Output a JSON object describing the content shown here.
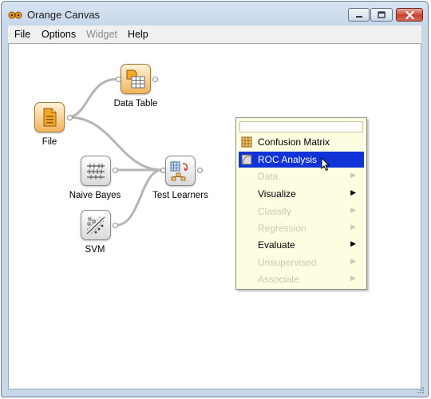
{
  "window": {
    "title": "Orange Canvas",
    "app_icon": "orange-app-icon",
    "controls": [
      "minimize-icon",
      "maximize-icon",
      "close-icon"
    ]
  },
  "menubar": {
    "items": [
      {
        "label": "File",
        "enabled": true
      },
      {
        "label": "Options",
        "enabled": true
      },
      {
        "label": "Widget",
        "enabled": false
      },
      {
        "label": "Help",
        "enabled": true
      }
    ]
  },
  "canvas": {
    "widgets": [
      {
        "id": "file",
        "label": "File",
        "icon": "file-widget-icon"
      },
      {
        "id": "data_table",
        "label": "Data Table",
        "icon": "data-table-icon"
      },
      {
        "id": "naive_bayes",
        "label": "Naive Bayes",
        "icon": "naive-bayes-icon"
      },
      {
        "id": "test_learners",
        "label": "Test Learners",
        "icon": "test-learners-icon"
      },
      {
        "id": "svm",
        "label": "SVM",
        "icon": "svm-icon"
      }
    ]
  },
  "popup": {
    "search_value": "",
    "items": [
      {
        "label": "Confusion Matrix",
        "icon": "confusion-matrix-icon",
        "enabled": true,
        "highlighted": false,
        "submenu": false
      },
      {
        "label": "ROC Analysis",
        "icon": "roc-analysis-icon",
        "enabled": true,
        "highlighted": true,
        "submenu": false
      },
      {
        "label": "Data",
        "enabled": false,
        "submenu": true
      },
      {
        "label": "Visualize",
        "enabled": true,
        "submenu": true
      },
      {
        "label": "Classify",
        "enabled": false,
        "submenu": true
      },
      {
        "label": "Regression",
        "enabled": false,
        "submenu": true
      },
      {
        "label": "Evaluate",
        "enabled": true,
        "submenu": true
      },
      {
        "label": "Unsupervised",
        "enabled": false,
        "submenu": true
      },
      {
        "label": "Associate",
        "enabled": false,
        "submenu": true
      }
    ],
    "submenu_arrow": "▶"
  },
  "colors": {
    "highlight": "#0f33d6",
    "popup_bg": "#fdfde2",
    "link": "#b5b5b5",
    "widget_orange": "#f2b45a"
  }
}
